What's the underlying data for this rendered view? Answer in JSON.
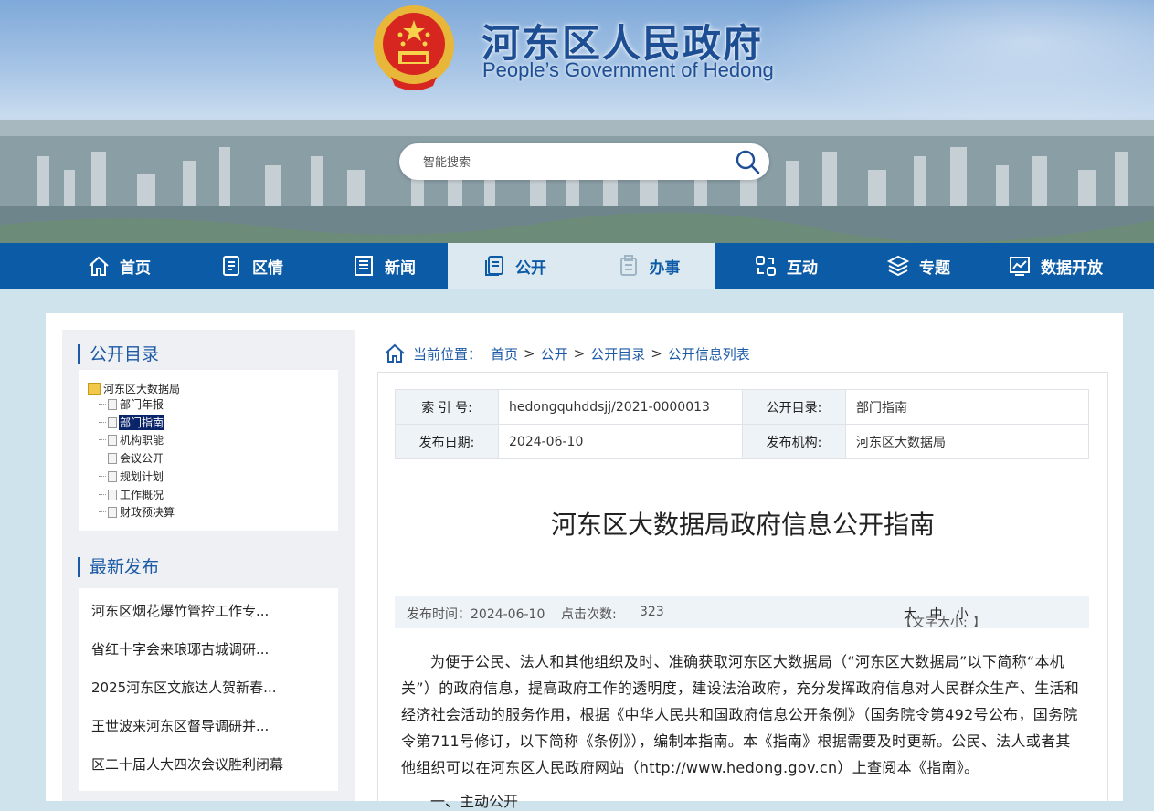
{
  "header": {
    "title": "河东区人民政府",
    "subtitle": "People’s Government of Hedong",
    "search_placeholder": "智能搜索"
  },
  "nav": [
    {
      "label": "首页",
      "icon": "home-icon"
    },
    {
      "label": "区情",
      "icon": "document-icon"
    },
    {
      "label": "新闻",
      "icon": "news-icon"
    },
    {
      "label": "公开",
      "icon": "open-file-icon"
    },
    {
      "label": "办事",
      "icon": "clipboard-icon"
    },
    {
      "label": "互动",
      "icon": "interact-icon"
    },
    {
      "label": "专题",
      "icon": "layers-icon"
    },
    {
      "label": "数据开放",
      "icon": "data-chart-icon"
    }
  ],
  "sidebar": {
    "catalog_title": "公开目录",
    "tree_root": "河东区大数据局",
    "tree_items": [
      "部门年报",
      "部门指南",
      "机构职能",
      "会议公开",
      "规划计划",
      "工作概况",
      "财政预决算"
    ],
    "selected": "部门指南",
    "latest_title": "最新发布",
    "latest": [
      "河东区烟花爆竹管控工作专...",
      "省红十字会来琅琊古城调研...",
      "2025河东区文旅达人贺新春...",
      "王世波来河东区督导调研并...",
      "区二十届人大四次会议胜利闭幕"
    ]
  },
  "breadcrumb": {
    "prefix": "当前位置：",
    "items": [
      "首页",
      "公开",
      "公开目录",
      "公开信息列表"
    ],
    "sep": ">"
  },
  "meta": {
    "index_label": "索 引 号:",
    "index_value": "hedongquhddsjj/2021-0000013",
    "catalog_label": "公开目录:",
    "catalog_value": "部门指南",
    "date_label": "发布日期:",
    "date_value": "2024-06-10",
    "org_label": "发布机构:",
    "org_value": "河东区大数据局"
  },
  "article": {
    "title": "河东区大数据局政府信息公开指南",
    "publish_time": "发布时间：2024-06-10",
    "clicks_label": "点击次数:",
    "clicks": "323",
    "font_size_label": "【文字大小:",
    "size_large": "大",
    "size_medium": "中",
    "size_small": "小",
    "font_size_end": "】",
    "paragraph": "为便于公民、法人和其他组织及时、准确获取河东区大数据局（“河东区大数据局”以下简称“本机关”）的政府信息，提高政府工作的透明度，建设法治政府，充分发挥政府信息对人民群众生产、生活和经济社会活动的服务作用，根据《中华人民共和国政府信息公开条例》（国务院令第492号公布，国务院令第711号修订，以下简称《条例》），编制本指南。本《指南》根据需要及时更新。公民、法人或者其他组织可以在河东区人民政府网站（http://www.hedong.gov.cn）上查阅本《指南》。",
    "next_line": "一、主动公开"
  },
  "colors": {
    "nav_bg": "#0c5ba6",
    "accent": "#1d5aa6",
    "active_bg": "#dde9f1"
  }
}
